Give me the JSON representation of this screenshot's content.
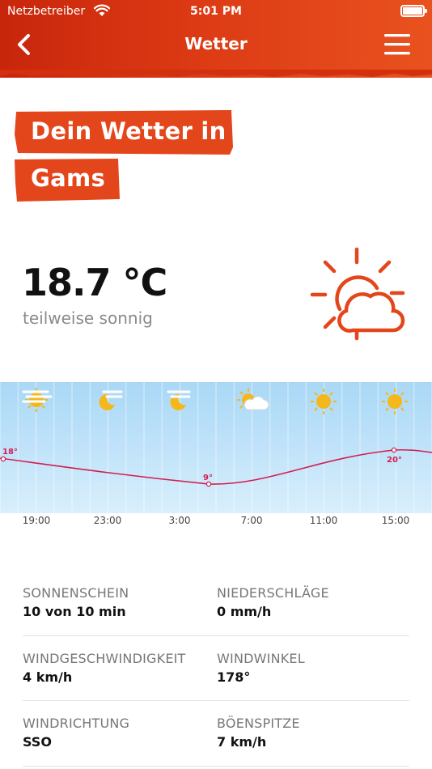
{
  "status_bar": {
    "carrier": "Netzbetreiber",
    "time": "5:01 PM"
  },
  "nav": {
    "title": "Wetter"
  },
  "headline": {
    "line1": "Dein Wetter in",
    "line2": "Gams"
  },
  "current": {
    "temperature": "18.7 °C",
    "condition": "teilweise sonnig",
    "icon": "partly-cloudy-icon"
  },
  "colors": {
    "header": "#d8350f",
    "accent": "#e4461c",
    "icon": "#e4461c",
    "temp_line": "#d21e4e"
  },
  "forecast": {
    "time_labels": [
      "19:00",
      "23:00",
      "3:00",
      "7:00",
      "11:00",
      "15:00"
    ],
    "icons": [
      "sun-haze-icon",
      "moon-haze-icon",
      "moon-haze-icon",
      "sun-cloud-icon",
      "sun-icon",
      "sun-icon"
    ],
    "temp_labels": [
      "18°",
      "9°",
      "20°"
    ]
  },
  "details": [
    {
      "label": "SONNENSCHEIN",
      "value": "10 von 10 min"
    },
    {
      "label": "NIEDERSCHLÄGE",
      "value": "0 mm/h"
    },
    {
      "label": "WINDGESCHWINDIGKEIT",
      "value": "4 km/h"
    },
    {
      "label": "WINDWINKEL",
      "value": "178°"
    },
    {
      "label": "WINDRICHTUNG",
      "value": "SSO"
    },
    {
      "label": "BÖENSPITZE",
      "value": "7 km/h"
    }
  ]
}
